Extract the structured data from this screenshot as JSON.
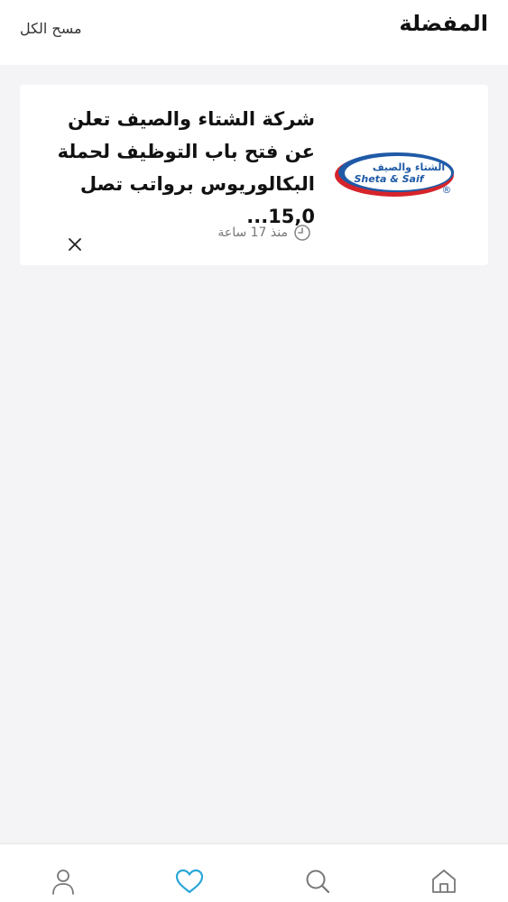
{
  "header": {
    "title": "المفضلة",
    "clear_all_label": "مسح الكل"
  },
  "favorites": [
    {
      "title": "شركة الشتاء والصيف تعلن عن فتح باب التوظيف لحملة البكالوريوس برواتب تصل 15,0...",
      "logo": {
        "arabic_text": "الشتاء والصيف",
        "latin_text": "Sheta & Saif",
        "mark": "®"
      },
      "time_ago": "منذ 17 ساعة"
    }
  ],
  "bottom_nav": {
    "items": [
      {
        "icon": "user-icon"
      },
      {
        "icon": "heart-icon",
        "active": true
      },
      {
        "icon": "search-icon"
      },
      {
        "icon": "home-icon"
      }
    ]
  },
  "colors": {
    "accent": "#2aa7d8",
    "logo_blue": "#1f5aa6",
    "logo_red": "#d6242b",
    "background": "#f4f4f6"
  }
}
